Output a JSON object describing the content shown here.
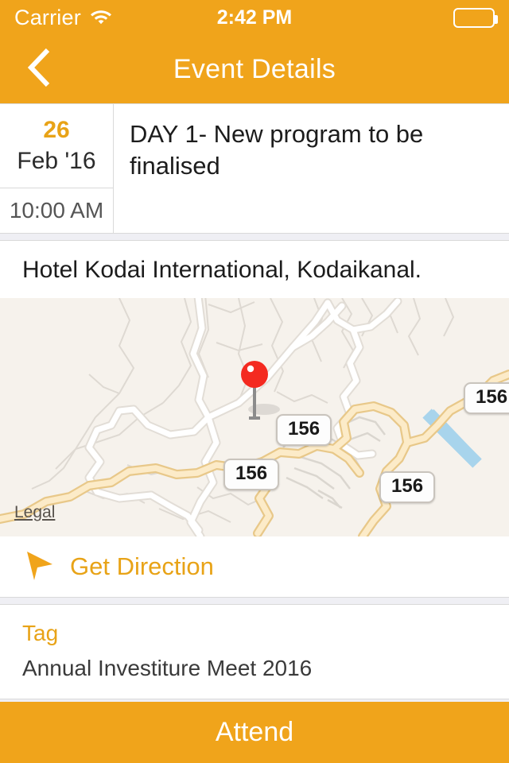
{
  "status_bar": {
    "carrier": "Carrier",
    "wifi_icon": "wifi-icon",
    "time": "2:42 PM",
    "battery_icon": "battery-icon"
  },
  "nav": {
    "back_icon": "chevron-left-icon",
    "title": "Event Details"
  },
  "event": {
    "day": "26",
    "month_year": "Feb '16",
    "time": "10:00 AM",
    "title": "DAY 1- New program to be finalised"
  },
  "venue": {
    "name": "Hotel Kodai International, Kodaikanal."
  },
  "map": {
    "pin_icon": "map-pin-icon",
    "legal_link": "Legal",
    "road_shields": [
      "156",
      "156",
      "156",
      "156"
    ],
    "background_color": "#F6F2EC",
    "road_color": "#F5D9A0",
    "water_color": "#A8D4EC"
  },
  "direction": {
    "icon": "navigation-arrow-icon",
    "label": "Get Direction"
  },
  "tag": {
    "heading": "Tag",
    "value": "Annual Investiture Meet 2016"
  },
  "attend": {
    "label": "Attend"
  },
  "colors": {
    "accent": "#F0A41B",
    "accent_text": "#E8A317"
  }
}
